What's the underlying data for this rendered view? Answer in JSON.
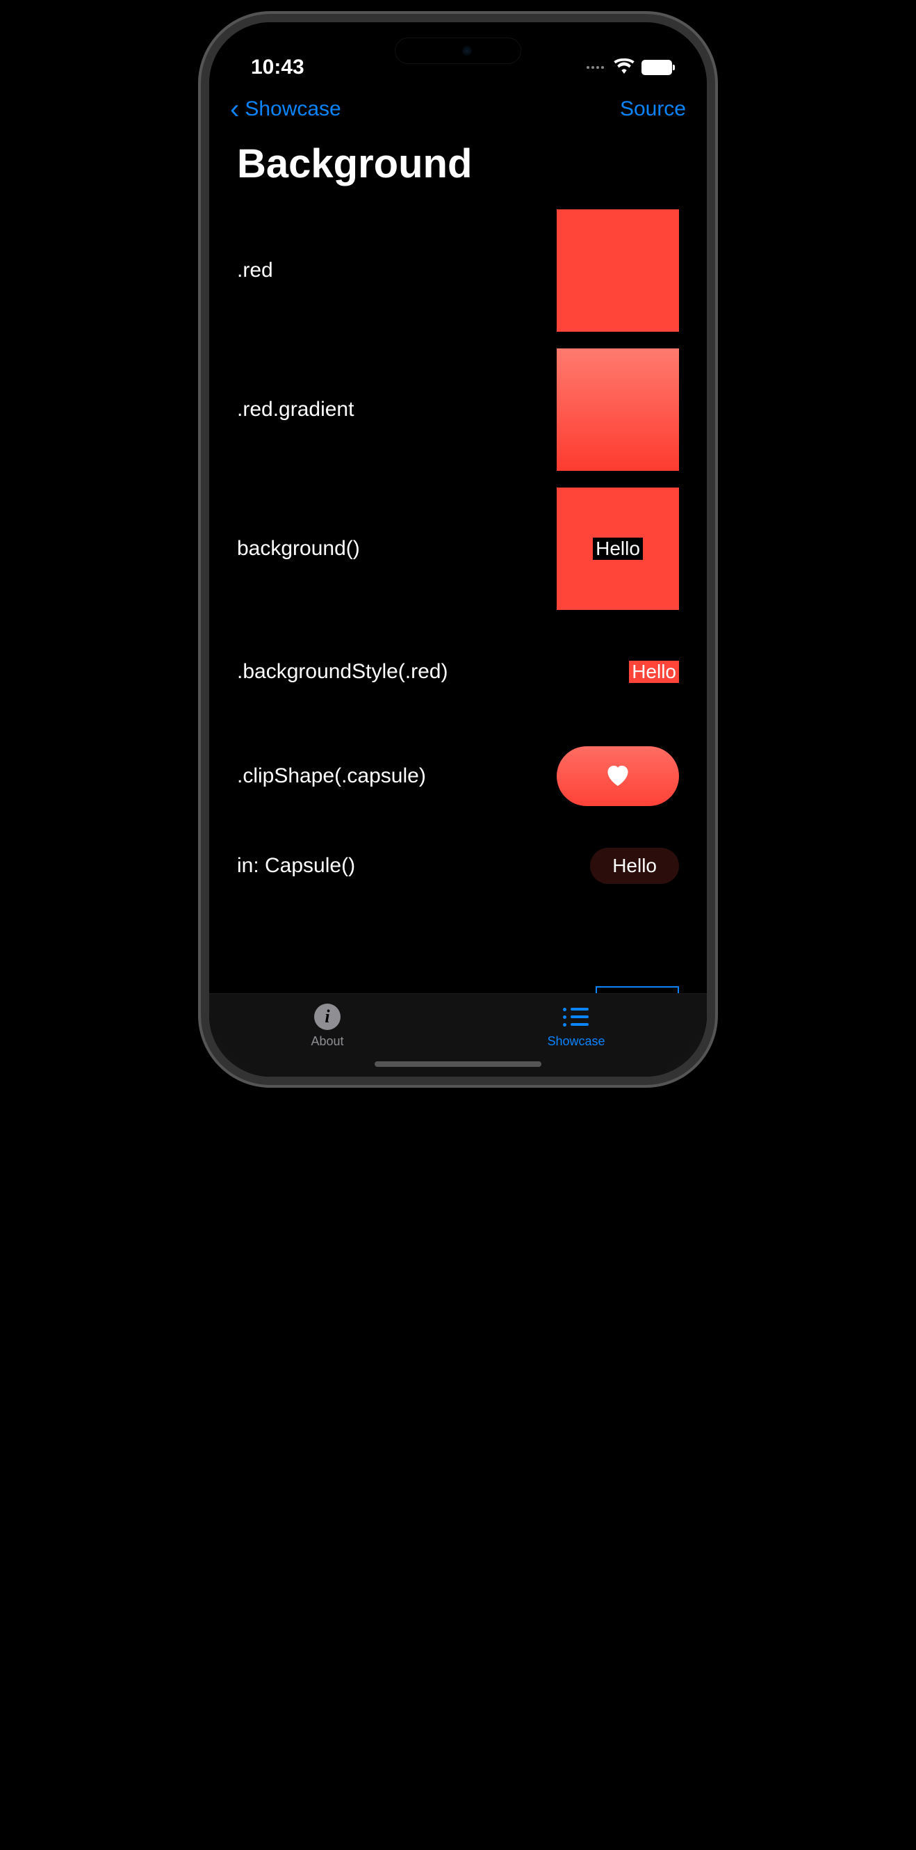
{
  "status": {
    "time": "10:43"
  },
  "nav": {
    "back_label": "Showcase",
    "source_label": "Source"
  },
  "page": {
    "title": "Background"
  },
  "rows": [
    {
      "label": ".red"
    },
    {
      "label": ".red.gradient"
    },
    {
      "label": "background()",
      "inner_text": "Hello"
    },
    {
      "label": ".backgroundStyle(.red)",
      "inner_text": "Hello"
    },
    {
      "label": ".clipShape(.capsule)"
    },
    {
      "label": "in: Capsule()",
      "inner_text": "Hello"
    }
  ],
  "tabs": {
    "about": {
      "label": "About"
    },
    "showcase": {
      "label": "Showcase"
    }
  },
  "icons": {
    "info_glyph": "i"
  },
  "colors": {
    "accent": "#0a84ff",
    "red": "#ff453a"
  }
}
